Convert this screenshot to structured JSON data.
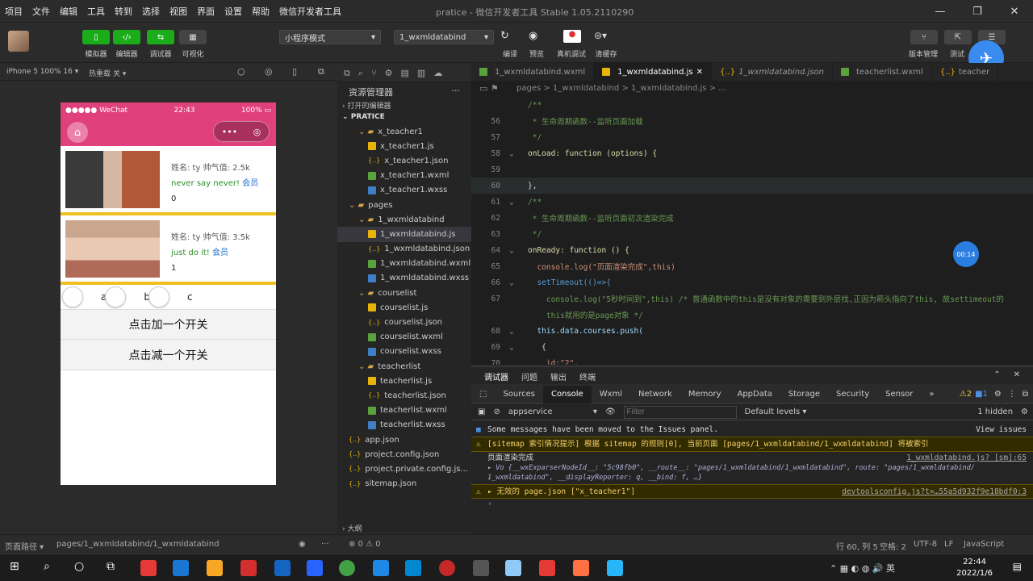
{
  "menu": [
    "项目",
    "文件",
    "编辑",
    "工具",
    "转到",
    "选择",
    "视图",
    "界面",
    "设置",
    "帮助",
    "微信开发者工具"
  ],
  "window_title": "pratice - 微信开发者工具 Stable 1.05.2110290",
  "window_buttons": [
    "—",
    "❐",
    "✕"
  ],
  "toolbar": {
    "buttons": [
      {
        "label": "模拟器",
        "icon": "phone-icon"
      },
      {
        "label": "编辑器",
        "icon": "code-icon"
      },
      {
        "label": "调试器",
        "icon": "debug-icon"
      },
      {
        "label": "可视化",
        "icon": "layout-icon"
      }
    ],
    "mode_select": "小程序模式",
    "page_select": "1_wxmldatabind",
    "actions": [
      "编译",
      "预览",
      "真机调试",
      "清缓存"
    ],
    "right_actions": [
      "版本管理",
      "测试"
    ]
  },
  "simulator": {
    "device": "iPhone 5 100% 16 ▾",
    "hot_reload": "热重载 关 ▾",
    "status_left": "●●●●● WeChat",
    "status_time": "22:43",
    "status_right": "100%",
    "cards": [
      {
        "name_line": "姓名: ty 帅气值: 2.5k",
        "quote": "never say never!",
        "vip": "会员",
        "count": "0"
      },
      {
        "name_line": "姓名: ty 帅气值: 3.5k",
        "quote": "just do it!",
        "vip": "会员",
        "count": "1"
      }
    ],
    "switch_labels": [
      "a",
      "b",
      "c"
    ],
    "add_button": "点击加一个开关",
    "sub_button": "点击减一个开关"
  },
  "explorer": {
    "title": "资源管理器",
    "open_editors": "打开的编辑器",
    "project": "PRATICE",
    "outline": "大纲",
    "tree": [
      {
        "label": "x_teacher1",
        "type": "folder",
        "indent": 1
      },
      {
        "label": "x_teacher1.js",
        "type": "js",
        "indent": 2
      },
      {
        "label": "x_teacher1.json",
        "type": "json",
        "indent": 2
      },
      {
        "label": "x_teacher1.wxml",
        "type": "wxml",
        "indent": 2
      },
      {
        "label": "x_teacher1.wxss",
        "type": "wxss",
        "indent": 2
      },
      {
        "label": "pages",
        "type": "folder",
        "indent": 0
      },
      {
        "label": "1_wxmldatabind",
        "type": "folder",
        "indent": 1
      },
      {
        "label": "1_wxmldatabind.js",
        "type": "js",
        "indent": 2,
        "selected": true
      },
      {
        "label": "1_wxmldatabind.json",
        "type": "json",
        "indent": 2
      },
      {
        "label": "1_wxmldatabind.wxml",
        "type": "wxml",
        "indent": 2
      },
      {
        "label": "1_wxmldatabind.wxss",
        "type": "wxss",
        "indent": 2
      },
      {
        "label": "courselist",
        "type": "folder",
        "indent": 1
      },
      {
        "label": "courselist.js",
        "type": "js",
        "indent": 2
      },
      {
        "label": "courselist.json",
        "type": "json",
        "indent": 2
      },
      {
        "label": "courselist.wxml",
        "type": "wxml",
        "indent": 2
      },
      {
        "label": "courselist.wxss",
        "type": "wxss",
        "indent": 2
      },
      {
        "label": "teacherlist",
        "type": "folder",
        "indent": 1
      },
      {
        "label": "teacherlist.js",
        "type": "js",
        "indent": 2
      },
      {
        "label": "teacherlist.json",
        "type": "json",
        "indent": 2
      },
      {
        "label": "teacherlist.wxml",
        "type": "wxml",
        "indent": 2
      },
      {
        "label": "teacherlist.wxss",
        "type": "wxss",
        "indent": 2
      },
      {
        "label": "app.json",
        "type": "json",
        "indent": 0
      },
      {
        "label": "project.config.json",
        "type": "json",
        "indent": 0
      },
      {
        "label": "project.private.config.js...",
        "type": "json",
        "indent": 0
      },
      {
        "label": "sitemap.json",
        "type": "json",
        "indent": 0
      }
    ]
  },
  "tabs": [
    "1_wxmldatabind.wxml",
    "1_wxmldatabind.js",
    "1_wxmldatabind.json",
    "teacherlist.wxml",
    "teacher"
  ],
  "breadcrumb": "pages > 1_wxmldatabind > 1_wxmldatabind.js > ...",
  "code_lines": [
    {
      "n": "",
      "t": "/**",
      "c": "cm"
    },
    {
      "n": "56",
      "t": " * 生命周期函数--监听页面加载",
      "c": "cm"
    },
    {
      "n": "57",
      "t": " */",
      "c": "cm"
    },
    {
      "n": "58",
      "t": "onLoad: function (options) {",
      "c": "fn",
      "fold": "⌄"
    },
    {
      "n": "59",
      "t": "",
      "c": ""
    },
    {
      "n": "60",
      "t": "},",
      "c": "",
      "hl": true
    },
    {
      "n": "61",
      "t": "/**",
      "c": "cm",
      "fold": "⌄"
    },
    {
      "n": "62",
      "t": " * 生命周期函数--监听页面初次渲染完成",
      "c": "cm"
    },
    {
      "n": "63",
      "t": " */",
      "c": "cm"
    },
    {
      "n": "64",
      "t": "onReady: function () {",
      "c": "fn",
      "fold": "⌄"
    },
    {
      "n": "65",
      "t": "  console.log(\"页面渲染完成\",this)",
      "c": "str"
    },
    {
      "n": "66",
      "t": "  setTimeout(()=>{",
      "c": "kw",
      "fold": "⌄"
    },
    {
      "n": "67",
      "t": "    console.log(\"5秒时间到\",this) /* 普通函数中的this是没有对象的需要到外层找,正因为箭头指向了this, 故settimeout的",
      "c": "cm"
    },
    {
      "n": "",
      "t": "    this就用的是page对象 */",
      "c": "cm"
    },
    {
      "n": "68",
      "t": "  this.data.courses.push(",
      "c": "prop",
      "fold": "⌄"
    },
    {
      "n": "69",
      "t": "   {",
      "c": "",
      "fold": "⌄"
    },
    {
      "n": "70",
      "t": "    id:\"2\",",
      "c": "str"
    }
  ],
  "timer_badge": "00:14",
  "panel_tabs": [
    "调试器",
    "问题",
    "输出",
    "终端"
  ],
  "dev_tabs": [
    "Sources",
    "Console",
    "Wxml",
    "Network",
    "Memory",
    "AppData",
    "Storage",
    "Security",
    "Sensor"
  ],
  "dev_counts": {
    "warn": "2",
    "info": "1"
  },
  "filter": {
    "context": "appservice",
    "placeholder": "Filter",
    "levels": "Default levels ▾",
    "hidden": "1 hidden"
  },
  "console": {
    "moved": "Some messages have been moved to the Issues panel.",
    "view_issues": "View issues",
    "sitemap_warn": "[sitemap 索引情况提示] 根据 sitemap 的规则[0], 当前页面 [pages/1_wxmldatabind/1_wxmldatabind] 将被索引",
    "render_done": "页面渲染完成",
    "render_src": "1_wxmldatabind.js? [sm]:65",
    "obj_line1": "▸ Vo {__wxExparserNodeId__: \"5c98fb0\", __route__: \"pages/1_wxmldatabind/1_wxmldatabind\", route: \"pages/1_wxmldatabind/",
    "obj_line2": "1_wxmldatabind\", __displayReporter: q, __bind: f, …}",
    "invalid_warn": "▸ 无效的 page.json [\"x_teacher1\"]",
    "invalid_src": "devtoolsconfig.js?t=…55a5d932f9e18bdf0:3",
    "prompt": "›"
  },
  "statusbar": {
    "left": "页面路径 ▾",
    "path": "pages/1_wxmldatabind/1_wxmldatabind",
    "errors": "⊗ 0 ⚠ 0",
    "position": "行 60, 列 5",
    "spaces": "空格: 2",
    "encoding": "UTF-8",
    "eol": "LF",
    "lang": "JavaScript"
  },
  "clock": {
    "time": "22:44",
    "date": "2022/1/6"
  }
}
